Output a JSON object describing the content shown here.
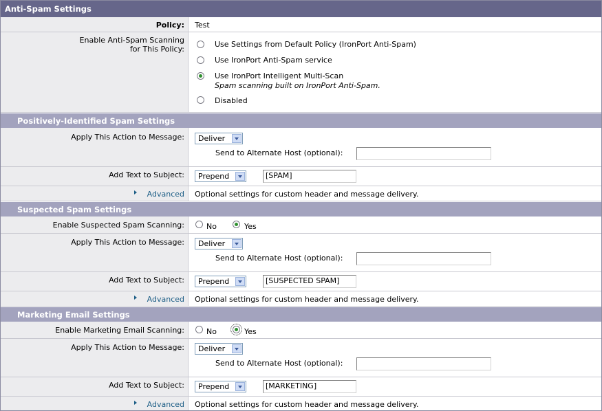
{
  "title": "Anti-Spam Settings",
  "policy": {
    "label": "Policy:",
    "value": "Test"
  },
  "scanning": {
    "label_line1": "Enable Anti-Spam Scanning",
    "label_line2": "for This Policy:",
    "options": [
      "Use Settings from Default Policy (IronPort Anti-Spam)",
      "Use IronPort Anti-Spam service",
      "Use IronPort Intelligent Multi-Scan",
      "Disabled"
    ],
    "multiscan_note": "Spam scanning built on IronPort Anti-Spam.",
    "selected": "Use IronPort Intelligent Multi-Scan"
  },
  "positive": {
    "heading": "Positively-Identified Spam Settings",
    "action_label": "Apply This Action to Message:",
    "action_value": "Deliver",
    "alt_host_label": "Send to Alternate Host (optional):",
    "alt_host_value": "",
    "subject_label": "Add Text to Subject:",
    "subject_mode": "Prepend",
    "subject_text": "[SPAM]",
    "advanced_label": "Advanced",
    "advanced_desc": "Optional settings for custom header and message delivery."
  },
  "suspected": {
    "heading": "Suspected Spam Settings",
    "enable_label": "Enable Suspected Spam Scanning:",
    "no_label": "No",
    "yes_label": "Yes",
    "enabled": "Yes",
    "action_label": "Apply This Action to Message:",
    "action_value": "Deliver",
    "alt_host_label": "Send to Alternate Host (optional):",
    "alt_host_value": "",
    "subject_label": "Add Text to Subject:",
    "subject_mode": "Prepend",
    "subject_text": "[SUSPECTED SPAM]",
    "advanced_label": "Advanced",
    "advanced_desc": "Optional settings for custom header and message delivery."
  },
  "marketing": {
    "heading": "Marketing Email Settings",
    "enable_label": "Enable Marketing Email Scanning:",
    "no_label": "No",
    "yes_label": "Yes",
    "enabled": "Yes",
    "action_label": "Apply This Action to Message:",
    "action_value": "Deliver",
    "alt_host_label": "Send to Alternate Host (optional):",
    "alt_host_value": "",
    "subject_label": "Add Text to Subject:",
    "subject_mode": "Prepend",
    "subject_text": "[MARKETING]",
    "advanced_label": "Advanced",
    "advanced_desc": "Optional settings for custom header and message delivery."
  },
  "colors": {
    "header": "#66668a",
    "section": "#a3a3be",
    "label_bg": "#ececee",
    "link": "#1d5e86",
    "radio_on": "#2f8f2f"
  }
}
